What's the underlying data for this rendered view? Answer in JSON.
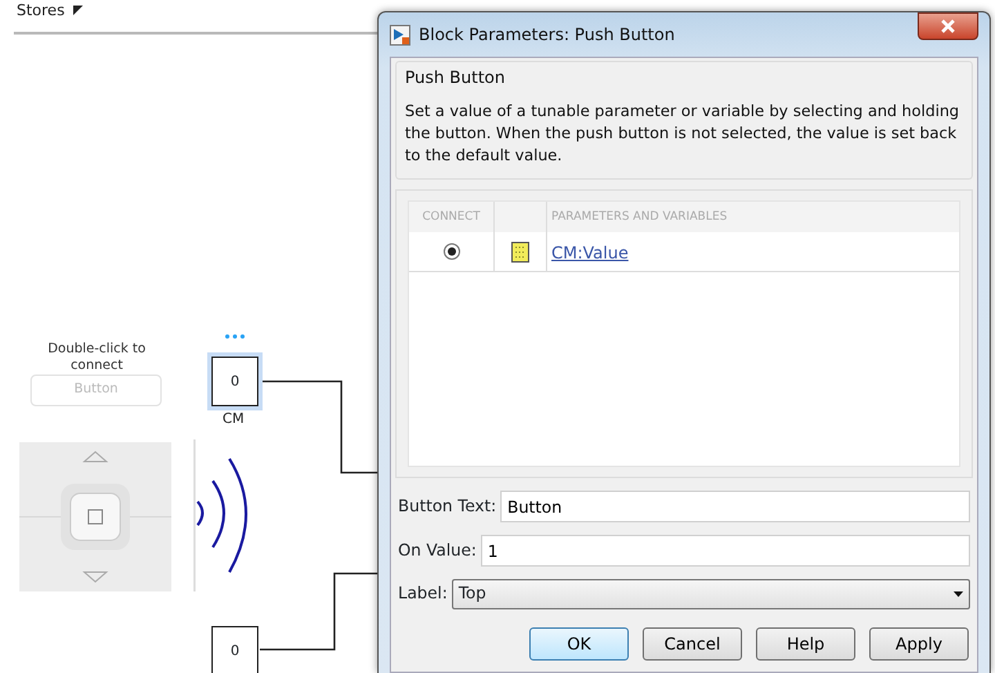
{
  "canvas": {
    "breadcrumb": "Stores",
    "hint": "Double-click to connect",
    "placeholder_button": "Button",
    "blocks": [
      {
        "value": "0",
        "label": "CM",
        "selected": true
      },
      {
        "value": "0",
        "selected": false
      }
    ]
  },
  "dialog": {
    "title": "Block Parameters: Push Button",
    "group_title": "Push Button",
    "description": "Set a value of a tunable parameter or variable by selecting and holding the button. When the push button is not selected, the value is set back to the default value.",
    "table": {
      "columns": [
        "CONNECT",
        "PARAMETERS AND VARIABLES"
      ],
      "rows": [
        {
          "connected": true,
          "name": "CM:Value"
        }
      ]
    },
    "fields": [
      {
        "kind": "text",
        "label": "Button Text:",
        "value": "Button"
      },
      {
        "kind": "text",
        "label": "On Value:",
        "value": "1"
      },
      {
        "kind": "select",
        "label": "Label:",
        "value": "Top"
      }
    ],
    "buttons": [
      {
        "label": "OK",
        "default": true
      },
      {
        "label": "Cancel",
        "default": false
      },
      {
        "label": "Help",
        "default": false
      },
      {
        "label": "Apply",
        "default": false
      }
    ]
  }
}
